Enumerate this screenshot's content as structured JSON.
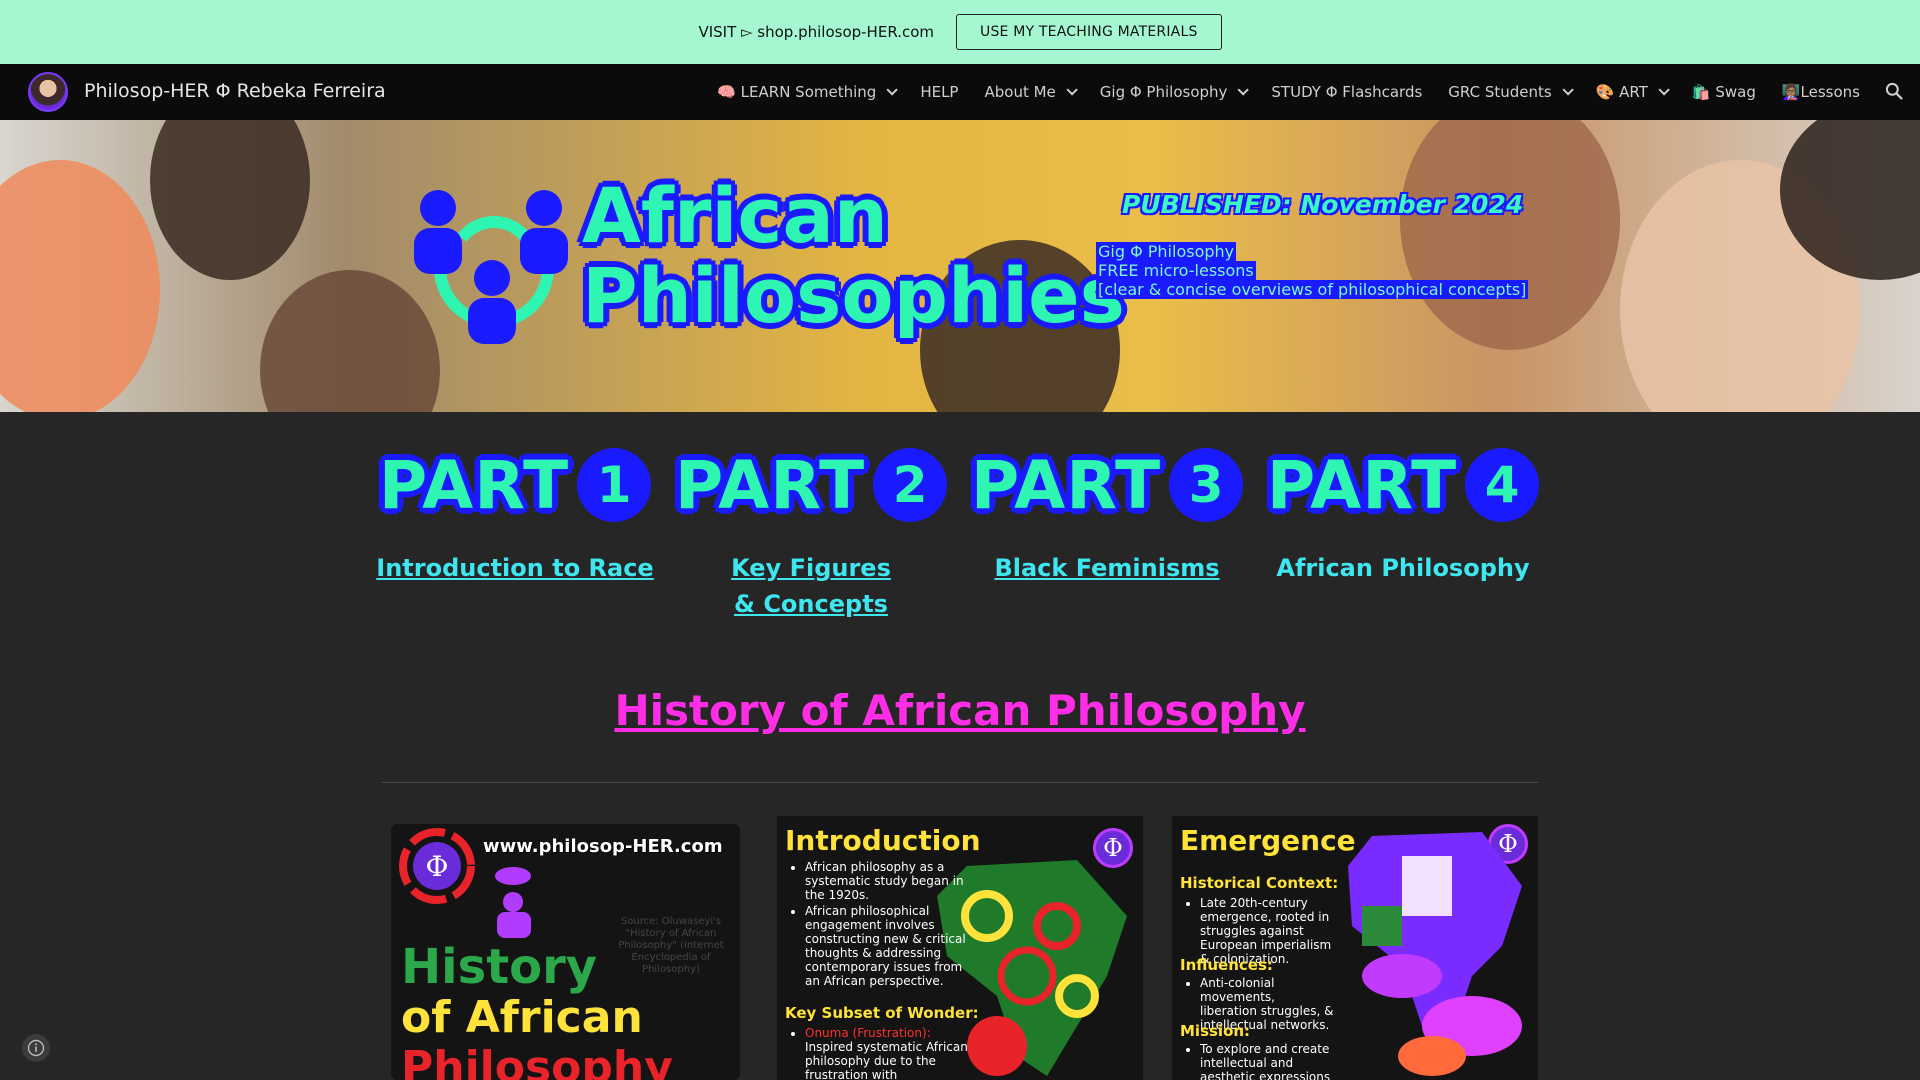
{
  "announce": {
    "text": "VISIT ▻ shop.philosop-HER.com",
    "button": "USE MY TEACHING MATERIALS"
  },
  "nav": {
    "site_title": "Philosop-HER Φ Rebeka Ferreira",
    "items": [
      {
        "label": "🧠 LEARN Something",
        "dropdown": true
      },
      {
        "label": "HELP",
        "dropdown": false
      },
      {
        "label": "About Me",
        "dropdown": true
      },
      {
        "label": "Gig Φ Philosophy",
        "dropdown": true
      },
      {
        "label": "STUDY Φ Flashcards",
        "dropdown": false
      },
      {
        "label": "GRC Students",
        "dropdown": true
      },
      {
        "label": "🎨 ART",
        "dropdown": true
      },
      {
        "label": "🛍️ Swag",
        "dropdown": false
      },
      {
        "label": "👩🏽‍🏫Lessons",
        "dropdown": false
      }
    ]
  },
  "hero": {
    "title_line1": "African",
    "title_line2": "Philosophies",
    "published": "PUBLISHED: November 2024",
    "sub": [
      "Gig Φ Philosophy",
      "FREE micro-lessons",
      "[clear & concise overviews of philosophical concepts]"
    ]
  },
  "parts": [
    {
      "word": "PART",
      "num": "1",
      "label": "Introduction to Race",
      "underline": true
    },
    {
      "word": "PART",
      "num": "2",
      "label": "Key Figures & Concepts",
      "underline": true
    },
    {
      "word": "PART",
      "num": "3",
      "label": "Black Feminisms",
      "underline": true
    },
    {
      "word": "PART",
      "num": "4",
      "label": "African Philosophy",
      "underline": false
    }
  ],
  "section": {
    "title": "History of African Philosophy"
  },
  "cards": {
    "c1": {
      "phi": "Φ",
      "url": "www.philosop-HER.com",
      "h1": "History",
      "h2": "of African",
      "h3": "Philosophy",
      "source": "Source: Oluwaseyi's \"History of African Philosophy\" (Internet Encyclopedia of Philosophy)"
    },
    "c2": {
      "phi": "Φ",
      "heading": "Introduction",
      "bullets": [
        "African philosophy as a systematic study began in the 1920s.",
        "African philosophical engagement involves constructing new & critical thoughts & addressing contemporary issues from an African perspective."
      ],
      "sub": "Key Subset of Wonder:",
      "sub_term": "Onuma (Frustration):",
      "sub_text": "Inspired systematic African philosophy due to the frustration with"
    },
    "c3": {
      "phi": "Φ",
      "heading": "Emergence",
      "sub1": "Historical Context:",
      "b1": "Late 20th-century emergence, rooted in struggles against European imperialism & colonization.",
      "sub2": "Influences:",
      "b2": "Anti-colonial movements, liberation struggles, & intellectual networks.",
      "sub3": "Mission:",
      "b3": "To explore and create intellectual and aesthetic expressions aiding quests"
    }
  },
  "colors": {
    "announce_bg": "#a4f7cf",
    "nav_bg": "#0b0b0b",
    "page_bg": "#262626",
    "accent_green": "#2ef5b2",
    "accent_blue": "#1a1aff",
    "link_cyan": "#3ee6f0",
    "title_magenta": "#ff2ee6"
  },
  "icons": [
    "search-icon",
    "chevron-down-icon",
    "info-icon",
    "people-circle-icon",
    "phi-icon"
  ]
}
